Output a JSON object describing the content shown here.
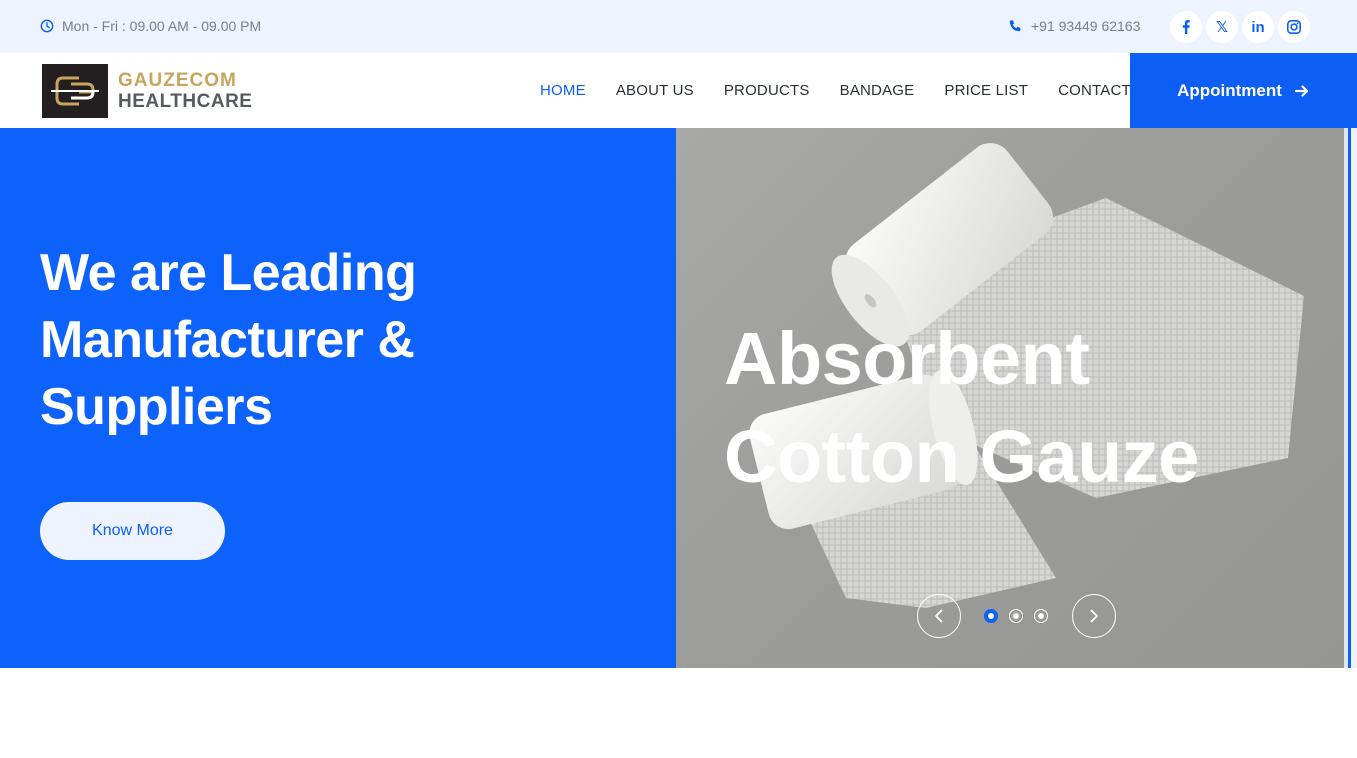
{
  "topbar": {
    "hours": "Mon - Fri : 09.00 AM - 09.00 PM",
    "phone": "+91 93449 62163",
    "socials": [
      {
        "icon": "facebook-icon",
        "label": "f"
      },
      {
        "icon": "x-twitter-icon",
        "label": "𝕏"
      },
      {
        "icon": "linkedin-icon",
        "label": "in"
      },
      {
        "icon": "instagram-icon",
        "label": ""
      }
    ]
  },
  "header": {
    "logo_line1": "GAUZECOM",
    "logo_line2": "HEALTHCARE",
    "nav": [
      "HOME",
      "ABOUT US",
      "PRODUCTS",
      "BANDAGE",
      "PRICE LIST",
      "CONTACT"
    ],
    "active_nav": "HOME",
    "appointment": "Appointment"
  },
  "hero": {
    "title_lines": [
      "We are Leading",
      "Manufacturer &",
      "Suppliers"
    ],
    "cta": "Know More",
    "slide_title_lines": [
      "Absorbent",
      "Cotton Gauze"
    ],
    "slide_count": 3,
    "active_slide": 1
  },
  "colors": {
    "primary": "#0d5ef4",
    "topbar_bg": "#edf4ff",
    "logo_gold": "#c9a45c"
  }
}
